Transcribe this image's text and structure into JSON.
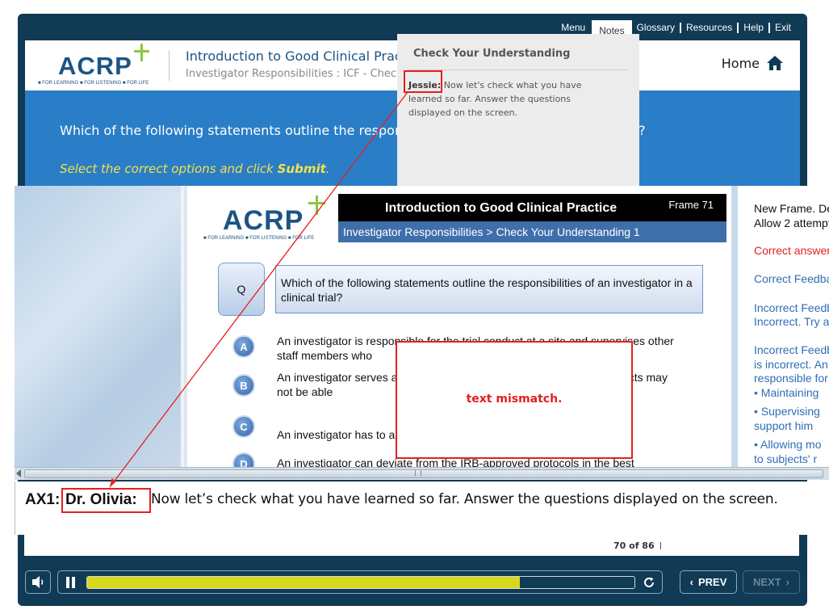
{
  "topnav": {
    "items": [
      "Menu",
      "Notes",
      "Glossary",
      "Resources",
      "Help",
      "Exit"
    ],
    "active": "Notes"
  },
  "header": {
    "logo_text": "ACRP",
    "logo_tagline": "■ FOR LEARNING ■ FOR LISTENING ■ FOR LIFE",
    "title": "Introduction to Good Clinical Pract",
    "subtitle": "Investigator Responsibilities : ICF - Chec",
    "home_label": "Home"
  },
  "band": {
    "question": "Which of the following statements outline the responsi",
    "question_tail": "al?",
    "instruction_prefix": "Select the correct options and click ",
    "instruction_bold": "Submit",
    "instruction_suffix": "."
  },
  "notes": {
    "title": "Check Your Understanding",
    "speaker": "Jessie:",
    "text": " Now let's check what you have learned so far. Answer the questions displayed on the screen."
  },
  "slide": {
    "logo_text": "ACRP",
    "logo_tagline": "■ FOR LEARNING ■ FOR LISTENING ■ FOR LIFE",
    "title": "Introduction to Good Clinical Practice",
    "frame": "Frame 71",
    "breadcrumb": "Investigator Responsibilities  > Check Your Understanding  1",
    "q_label": "Q",
    "question": "Which of the following statements outline the responsibilities  of an investigator in a clinical trial?",
    "options": [
      {
        "letter": "A",
        "text": "An investigator is responsible  for the trial conduct at a site and supervises other staff members who"
      },
      {
        "letter": "B",
        "text": "An investigator serves as                                                       here subjects may not be able                                                       of the site."
      },
      {
        "letter": "C",
        "text": "An investigator has to allo                                                       ecords."
      },
      {
        "letter": "D",
        "text": "An investigator can deviate from the IRB-approved protocols in the best"
      }
    ],
    "mismatch_text": "text mismatch."
  },
  "side_notes": [
    {
      "text": "New Frame. De",
      "color": "#111111"
    },
    {
      "text": "Allow 2 attempt",
      "color": "#111111"
    },
    {
      "text": "Correct answer",
      "color": "#e32020"
    },
    {
      "text": "Correct Feedba",
      "color": "#2f6db5"
    },
    {
      "text": "Incorrect Feedb",
      "color": "#2f6db5"
    },
    {
      "text": "Incorrect. Try a",
      "color": "#2f6db5"
    },
    {
      "text": "Incorrect Feedb",
      "color": "#2f6db5"
    },
    {
      "text": "is incorrect. An",
      "color": "#2f6db5"
    },
    {
      "text": "responsible  for",
      "color": "#2f6db5"
    },
    {
      "text": "•  Maintaining",
      "color": "#2f6db5"
    },
    {
      "text": "•  Supervising",
      "color": "#2f6db5"
    },
    {
      "text": "    support him",
      "color": "#2f6db5"
    },
    {
      "text": "•  Allowing mo",
      "color": "#2f6db5"
    },
    {
      "text": "    to subjects' r",
      "color": "#2f6db5"
    }
  ],
  "transcript": {
    "prefix": "AX1:",
    "speaker": "Dr. Olivia:",
    "text": " Now let’s check what you have learned so far. Answer the questions displayed on the screen."
  },
  "footer": {
    "page_count": "70 of 86"
  },
  "controls": {
    "progress_fraction": 0.79,
    "prev_label": "PREV",
    "next_label": "NEXT",
    "progress_color": "#d7d81c"
  },
  "colors": {
    "frame": "#113a55",
    "band": "#2a7ec7",
    "annotation": "#e32020"
  }
}
